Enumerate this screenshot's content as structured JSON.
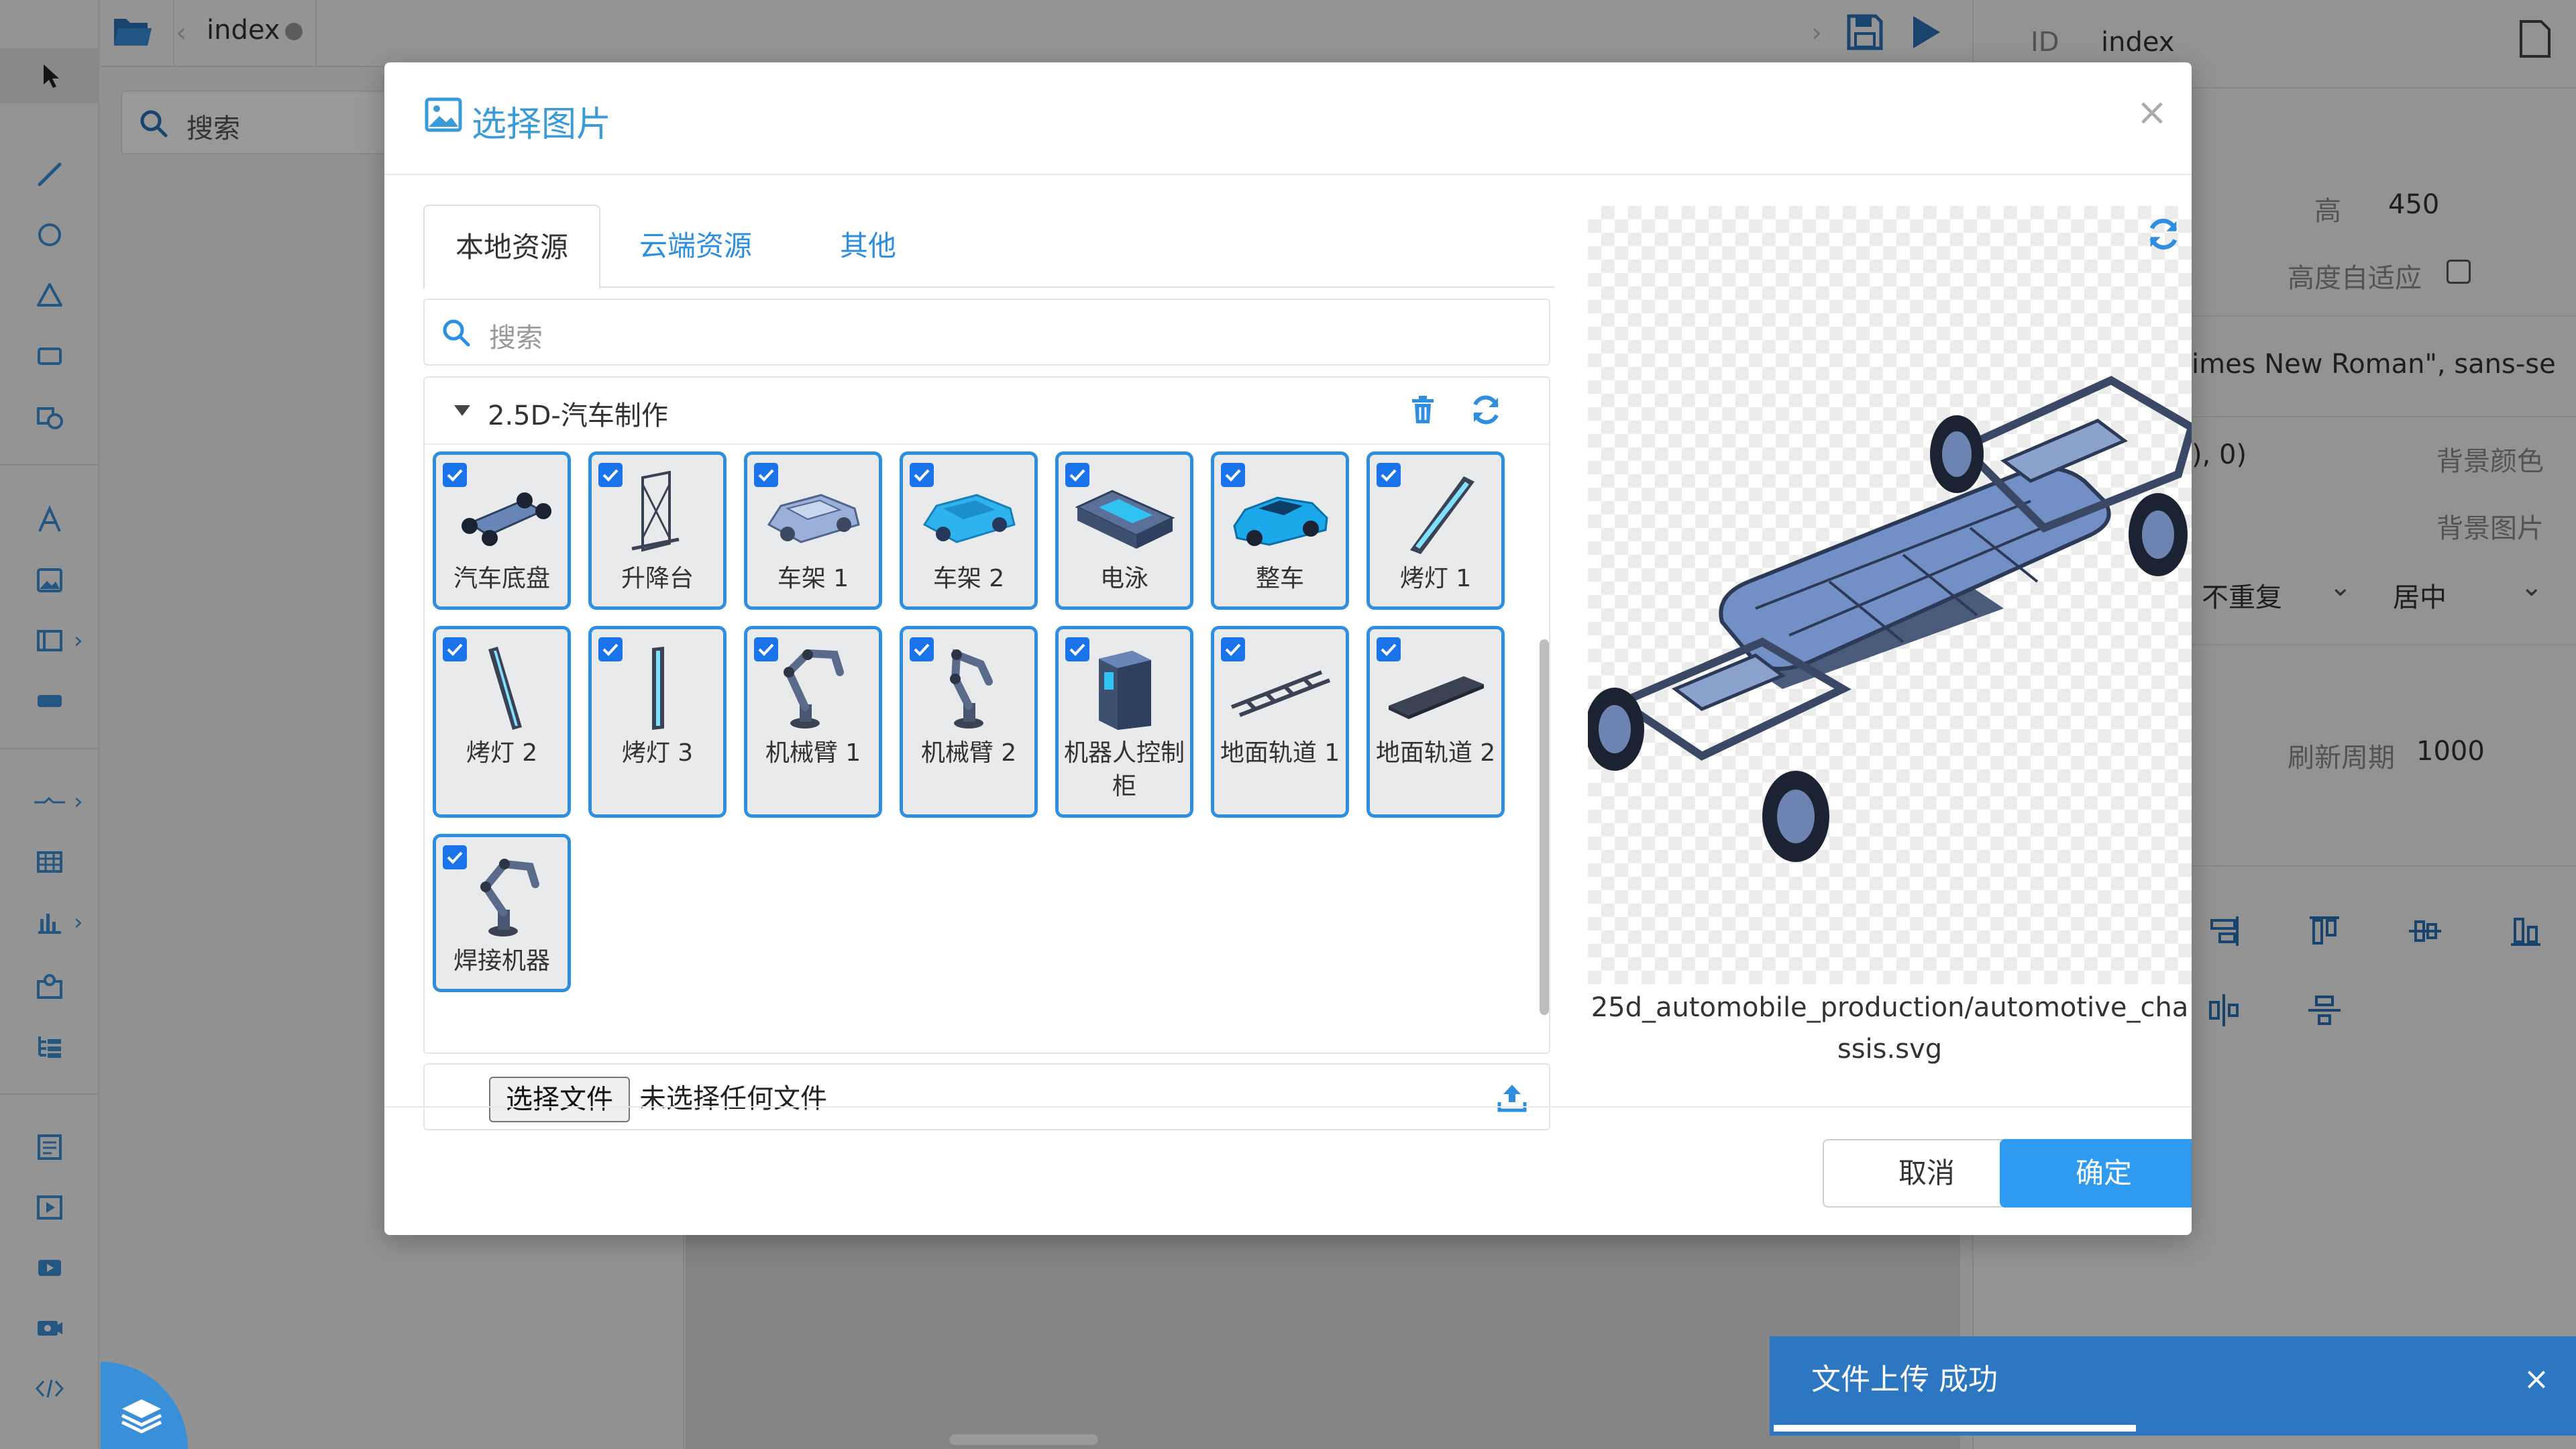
{
  "editor": {
    "file_tab": "index",
    "left_search_placeholder": "搜索"
  },
  "right_panel": {
    "id_label": "ID",
    "id_value": "index",
    "height_label": "高",
    "height_value": "450",
    "auto_height_label": "高度自适应",
    "font_value": "imes New Roman\", sans-se",
    "color_value": "), 0)",
    "bg_color_label": "背景颜色",
    "bg_image_label": "背景图片",
    "repeat_value": "不重复",
    "position_value": "居中",
    "refresh_label": "刷新周期",
    "refresh_value": "1000"
  },
  "dialog": {
    "title": "选择图片",
    "close_glyph": "×",
    "tabs": [
      {
        "label": "本地资源",
        "active": true
      },
      {
        "label": "云端资源",
        "active": false
      },
      {
        "label": "其他",
        "active": false
      }
    ],
    "search_placeholder": "搜索",
    "group_name": "2.5D-汽车制作",
    "items": [
      {
        "label": "汽车底盘",
        "checked": true,
        "icon": "chassis"
      },
      {
        "label": "升降台",
        "checked": true,
        "icon": "lift"
      },
      {
        "label": "车架 1",
        "checked": true,
        "icon": "frame1"
      },
      {
        "label": "车架 2",
        "checked": true,
        "icon": "frame2"
      },
      {
        "label": "电泳",
        "checked": true,
        "icon": "tank"
      },
      {
        "label": "整车",
        "checked": true,
        "icon": "car"
      },
      {
        "label": "烤灯 1",
        "checked": true,
        "icon": "lamp"
      },
      {
        "label": "烤灯 2",
        "checked": true,
        "icon": "lamp"
      },
      {
        "label": "烤灯 3",
        "checked": true,
        "icon": "lamp"
      },
      {
        "label": "机械臂 1",
        "checked": true,
        "icon": "robot-arm"
      },
      {
        "label": "机械臂 2",
        "checked": true,
        "icon": "robot-arm"
      },
      {
        "label": "机器人控制柜",
        "checked": true,
        "icon": "cabinet"
      },
      {
        "label": "地面轨道 1",
        "checked": true,
        "icon": "rail"
      },
      {
        "label": "地面轨道 2",
        "checked": true,
        "icon": "plate"
      },
      {
        "label": "焊接机器",
        "checked": true,
        "icon": "robot-arm"
      }
    ],
    "choose_file_label": "选择文件",
    "no_file_text": "未选择任何文件",
    "preview_path": "25d_automobile_production/automotive_chassis.svg",
    "cancel_label": "取消",
    "ok_label": "确定"
  },
  "toast": {
    "message": "文件上传 成功",
    "close_glyph": "×"
  },
  "colors": {
    "accent": "#2e8fe0",
    "ok_button": "#2e9bf0",
    "toast_bg": "#2d77c2",
    "checkbox": "#1a73e8"
  }
}
